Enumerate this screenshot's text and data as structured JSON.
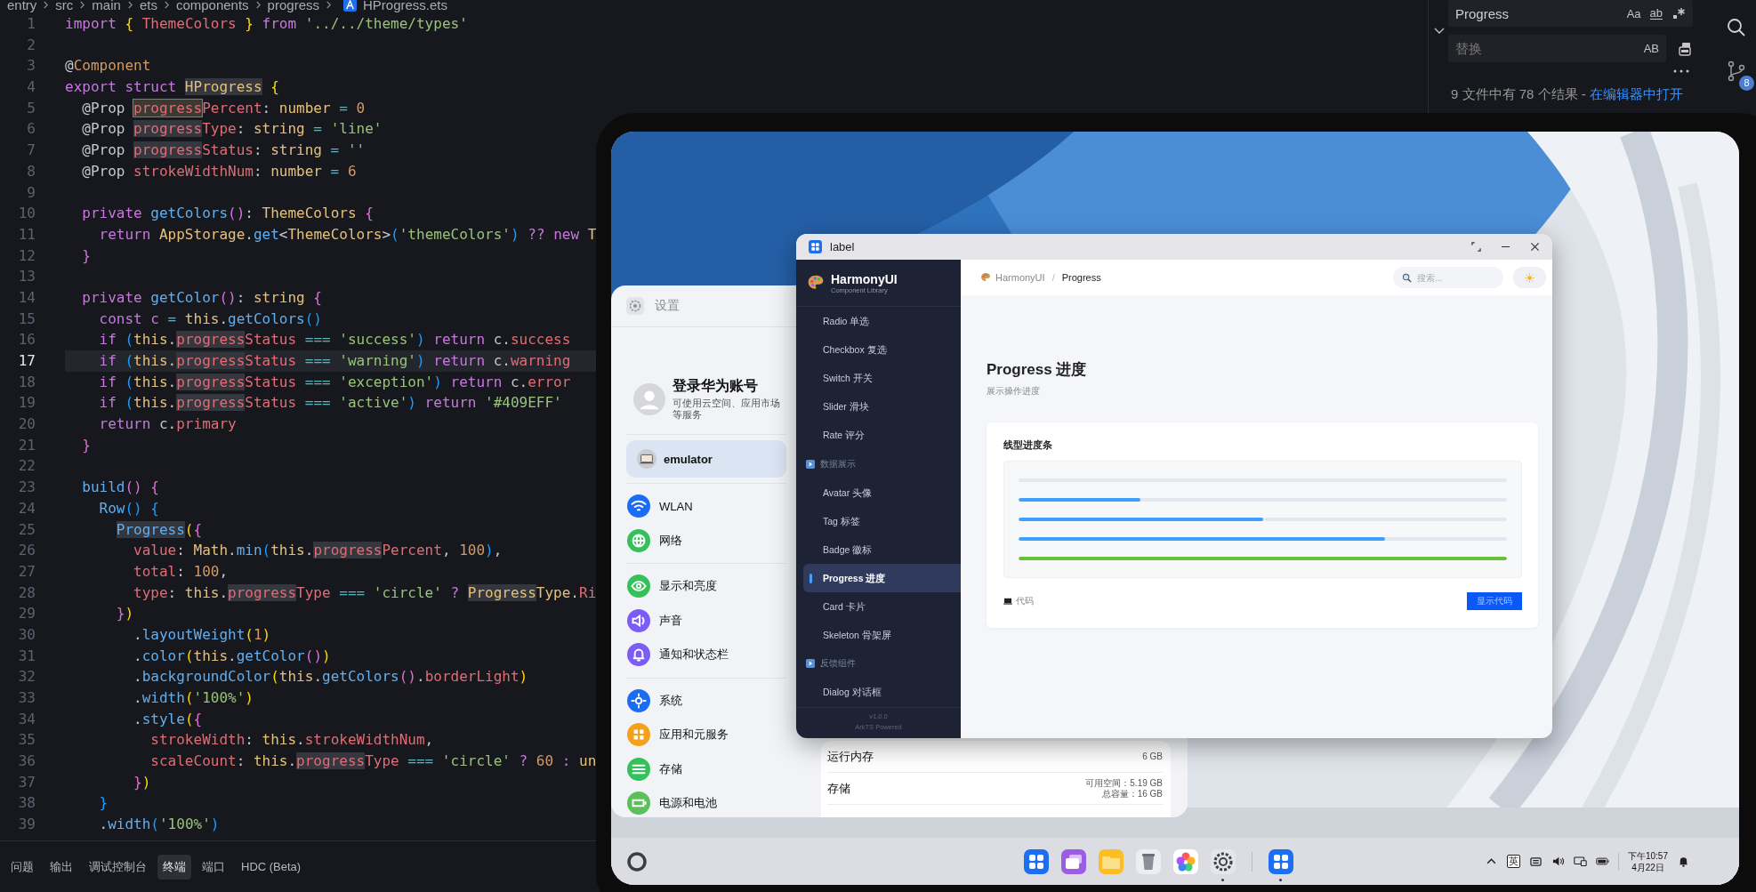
{
  "editor": {
    "breadcrumb": [
      "entry",
      "src",
      "main",
      "ets",
      "components",
      "progress",
      "HProgress.ets"
    ],
    "lines": [
      {
        "number": "1",
        "current": false,
        "tokens": [
          {
            "text": "import ",
            "kind": "kw"
          },
          {
            "text": "{",
            "kind": "b1"
          },
          {
            "text": " ThemeColors ",
            "kind": "prop"
          },
          {
            "text": "}",
            "kind": "b1"
          },
          {
            "text": " from ",
            "kind": "kw"
          },
          {
            "text": "'../../theme/types'",
            "kind": "str"
          }
        ]
      },
      {
        "number": "2",
        "current": false
      },
      {
        "number": "3",
        "current": false,
        "tokens": [
          {
            "text": "@",
            "kind": "p"
          },
          {
            "text": "Component",
            "kind": "num"
          }
        ]
      },
      {
        "number": "4",
        "current": false,
        "tokens": [
          {
            "text": "export struct ",
            "kind": "kw"
          },
          {
            "text": "HProgress",
            "kind": "typehit"
          },
          {
            "text": " {",
            "kind": "b1"
          }
        ]
      },
      {
        "number": "5",
        "current": false,
        "tokens": [
          {
            "text": "  @Prop ",
            "kind": "p"
          },
          {
            "text": "progress",
            "kind": "hitbox"
          },
          {
            "text": "Percent",
            "kind": "prop"
          },
          {
            "text": ": ",
            "kind": "p"
          },
          {
            "text": "number",
            "kind": "type"
          },
          {
            "text": " = ",
            "kind": "op"
          },
          {
            "text": "0",
            "kind": "num"
          }
        ]
      },
      {
        "number": "6",
        "current": false,
        "tokens": [
          {
            "text": "  @Prop ",
            "kind": "p"
          },
          {
            "text": "progress",
            "kind": "hit"
          },
          {
            "text": "Type",
            "kind": "prop"
          },
          {
            "text": ": ",
            "kind": "p"
          },
          {
            "text": "string",
            "kind": "type"
          },
          {
            "text": " = ",
            "kind": "op"
          },
          {
            "text": "'line'",
            "kind": "str"
          }
        ]
      },
      {
        "number": "7",
        "current": false,
        "tokens": [
          {
            "text": "  @Prop ",
            "kind": "p"
          },
          {
            "text": "progress",
            "kind": "hit"
          },
          {
            "text": "Status",
            "kind": "prop"
          },
          {
            "text": ": ",
            "kind": "p"
          },
          {
            "text": "string",
            "kind": "type"
          },
          {
            "text": " = ",
            "kind": "op"
          },
          {
            "text": "''",
            "kind": "str"
          }
        ]
      },
      {
        "number": "8",
        "current": false,
        "tokens": [
          {
            "text": "  @Prop ",
            "kind": "p"
          },
          {
            "text": "strokeWidthNum",
            "kind": "prop"
          },
          {
            "text": ": ",
            "kind": "p"
          },
          {
            "text": "number",
            "kind": "type"
          },
          {
            "text": " = ",
            "kind": "op"
          },
          {
            "text": "6",
            "kind": "num"
          }
        ]
      },
      {
        "number": "9",
        "current": false
      },
      {
        "number": "10",
        "current": false,
        "tokens": [
          {
            "text": "  private ",
            "kind": "kw"
          },
          {
            "text": "getColors",
            "kind": "fn"
          },
          {
            "text": "()",
            "kind": "b2"
          },
          {
            "text": ": ",
            "kind": "p"
          },
          {
            "text": "ThemeColors",
            "kind": "type"
          },
          {
            "text": " {",
            "kind": "b2"
          }
        ]
      },
      {
        "number": "11",
        "current": false,
        "tokens": [
          {
            "text": "    return ",
            "kind": "kw"
          },
          {
            "text": "AppStorage",
            "kind": "type"
          },
          {
            "text": ".",
            "kind": "p"
          },
          {
            "text": "get",
            "kind": "fn"
          },
          {
            "text": "<",
            "kind": "p"
          },
          {
            "text": "ThemeColors",
            "kind": "type"
          },
          {
            "text": ">",
            "kind": "p"
          },
          {
            "text": "(",
            "kind": "b3"
          },
          {
            "text": "'themeColors'",
            "kind": "str"
          },
          {
            "text": ")",
            "kind": "b3"
          },
          {
            "text": " ?? new ",
            "kind": "kw"
          },
          {
            "text": "T",
            "kind": "type"
          }
        ]
      },
      {
        "number": "12",
        "current": false,
        "tokens": [
          {
            "text": "  }",
            "kind": "b2"
          }
        ]
      },
      {
        "number": "13",
        "current": false
      },
      {
        "number": "14",
        "current": false,
        "tokens": [
          {
            "text": "  private ",
            "kind": "kw"
          },
          {
            "text": "getColor",
            "kind": "fn"
          },
          {
            "text": "()",
            "kind": "b2"
          },
          {
            "text": ": ",
            "kind": "p"
          },
          {
            "text": "string",
            "kind": "type"
          },
          {
            "text": " {",
            "kind": "b2"
          }
        ]
      },
      {
        "number": "15",
        "current": false,
        "tokens": [
          {
            "text": "    const c ",
            "kind": "kw"
          },
          {
            "text": "= ",
            "kind": "op"
          },
          {
            "text": "this",
            "kind": "type"
          },
          {
            "text": ".",
            "kind": "p"
          },
          {
            "text": "getColors",
            "kind": "fn"
          },
          {
            "text": "()",
            "kind": "b3"
          }
        ]
      },
      {
        "number": "16",
        "current": false,
        "tokens": [
          {
            "text": "    if ",
            "kind": "kw"
          },
          {
            "text": "(",
            "kind": "b3"
          },
          {
            "text": "this",
            "kind": "type"
          },
          {
            "text": ".",
            "kind": "p"
          },
          {
            "text": "progress",
            "kind": "hit"
          },
          {
            "text": "Status",
            "kind": "prop"
          },
          {
            "text": " === ",
            "kind": "op"
          },
          {
            "text": "'success'",
            "kind": "str"
          },
          {
            "text": ")",
            "kind": "b3"
          },
          {
            "text": " return ",
            "kind": "kw"
          },
          {
            "text": "c.",
            "kind": "p"
          },
          {
            "text": "success",
            "kind": "prop"
          }
        ]
      },
      {
        "number": "17",
        "current": true,
        "tokens": [
          {
            "text": "    if ",
            "kind": "kw"
          },
          {
            "text": "(",
            "kind": "b3"
          },
          {
            "text": "this",
            "kind": "type"
          },
          {
            "text": ".",
            "kind": "p"
          },
          {
            "text": "progress",
            "kind": "hit"
          },
          {
            "text": "Status",
            "kind": "prop"
          },
          {
            "text": " === ",
            "kind": "op"
          },
          {
            "text": "'warning'",
            "kind": "str"
          },
          {
            "text": ")",
            "kind": "b3"
          },
          {
            "text": " return ",
            "kind": "kw"
          },
          {
            "text": "c.",
            "kind": "p"
          },
          {
            "text": "warning",
            "kind": "prop"
          }
        ]
      },
      {
        "number": "18",
        "current": false,
        "tokens": [
          {
            "text": "    if ",
            "kind": "kw"
          },
          {
            "text": "(",
            "kind": "b3"
          },
          {
            "text": "this",
            "kind": "type"
          },
          {
            "text": ".",
            "kind": "p"
          },
          {
            "text": "progress",
            "kind": "hit"
          },
          {
            "text": "Status",
            "kind": "prop"
          },
          {
            "text": " === ",
            "kind": "op"
          },
          {
            "text": "'exception'",
            "kind": "str"
          },
          {
            "text": ")",
            "kind": "b3"
          },
          {
            "text": " return ",
            "kind": "kw"
          },
          {
            "text": "c.",
            "kind": "p"
          },
          {
            "text": "error",
            "kind": "prop"
          }
        ]
      },
      {
        "number": "19",
        "current": false,
        "tokens": [
          {
            "text": "    if ",
            "kind": "kw"
          },
          {
            "text": "(",
            "kind": "b3"
          },
          {
            "text": "this",
            "kind": "type"
          },
          {
            "text": ".",
            "kind": "p"
          },
          {
            "text": "progress",
            "kind": "hit"
          },
          {
            "text": "Status",
            "kind": "prop"
          },
          {
            "text": " === ",
            "kind": "op"
          },
          {
            "text": "'active'",
            "kind": "str"
          },
          {
            "text": ")",
            "kind": "b3"
          },
          {
            "text": " return ",
            "kind": "kw"
          },
          {
            "text": "'#409EFF'",
            "kind": "str"
          }
        ]
      },
      {
        "number": "20",
        "current": false,
        "tokens": [
          {
            "text": "    return ",
            "kind": "kw"
          },
          {
            "text": "c.",
            "kind": "p"
          },
          {
            "text": "primary",
            "kind": "prop"
          }
        ]
      },
      {
        "number": "21",
        "current": false,
        "tokens": [
          {
            "text": "  }",
            "kind": "b2"
          }
        ]
      },
      {
        "number": "22",
        "current": false
      },
      {
        "number": "23",
        "current": false,
        "tokens": [
          {
            "text": "  build",
            "kind": "fn"
          },
          {
            "text": "()",
            "kind": "b2"
          },
          {
            "text": " {",
            "kind": "b2"
          }
        ]
      },
      {
        "number": "24",
        "current": false,
        "tokens": [
          {
            "text": "    Row",
            "kind": "fn"
          },
          {
            "text": "()",
            "kind": "b3"
          },
          {
            "text": " {",
            "kind": "b3"
          }
        ]
      },
      {
        "number": "25",
        "current": false,
        "tokens": [
          {
            "text": "      Progress",
            "kind": "fnhit"
          },
          {
            "text": "(",
            "kind": "b1"
          },
          {
            "text": "{",
            "kind": "b2"
          }
        ]
      },
      {
        "number": "26",
        "current": false,
        "tokens": [
          {
            "text": "        value",
            "kind": "prop"
          },
          {
            "text": ": ",
            "kind": "p"
          },
          {
            "text": "Math",
            "kind": "type"
          },
          {
            "text": ".",
            "kind": "p"
          },
          {
            "text": "min",
            "kind": "fn"
          },
          {
            "text": "(",
            "kind": "b3"
          },
          {
            "text": "this",
            "kind": "type"
          },
          {
            "text": ".",
            "kind": "p"
          },
          {
            "text": "progress",
            "kind": "hit"
          },
          {
            "text": "Percent",
            "kind": "prop"
          },
          {
            "text": ", ",
            "kind": "p"
          },
          {
            "text": "100",
            "kind": "num"
          },
          {
            "text": ")",
            "kind": "b3"
          },
          {
            "text": ",",
            "kind": "p"
          }
        ]
      },
      {
        "number": "27",
        "current": false,
        "tokens": [
          {
            "text": "        total",
            "kind": "prop"
          },
          {
            "text": ": ",
            "kind": "p"
          },
          {
            "text": "100",
            "kind": "num"
          },
          {
            "text": ",",
            "kind": "p"
          }
        ]
      },
      {
        "number": "28",
        "current": false,
        "tokens": [
          {
            "text": "        type",
            "kind": "prop"
          },
          {
            "text": ": ",
            "kind": "p"
          },
          {
            "text": "this",
            "kind": "type"
          },
          {
            "text": ".",
            "kind": "p"
          },
          {
            "text": "progress",
            "kind": "hit"
          },
          {
            "text": "Type",
            "kind": "prop"
          },
          {
            "text": " === ",
            "kind": "op"
          },
          {
            "text": "'circle'",
            "kind": "str"
          },
          {
            "text": " ? ",
            "kind": "kw"
          },
          {
            "text": "Progress",
            "kind": "typehit"
          },
          {
            "text": "Type",
            "kind": "type"
          },
          {
            "text": ".",
            "kind": "p"
          },
          {
            "text": "Ri",
            "kind": "prop"
          }
        ]
      },
      {
        "number": "29",
        "current": false,
        "tokens": [
          {
            "text": "      }",
            "kind": "b2"
          },
          {
            "text": ")",
            "kind": "b1"
          }
        ]
      },
      {
        "number": "30",
        "current": false,
        "tokens": [
          {
            "text": "        .",
            "kind": "p"
          },
          {
            "text": "layoutWeight",
            "kind": "fn"
          },
          {
            "text": "(",
            "kind": "b1"
          },
          {
            "text": "1",
            "kind": "num"
          },
          {
            "text": ")",
            "kind": "b1"
          }
        ]
      },
      {
        "number": "31",
        "current": false,
        "tokens": [
          {
            "text": "        .",
            "kind": "p"
          },
          {
            "text": "color",
            "kind": "fn"
          },
          {
            "text": "(",
            "kind": "b1"
          },
          {
            "text": "this",
            "kind": "type"
          },
          {
            "text": ".",
            "kind": "p"
          },
          {
            "text": "getColor",
            "kind": "fn"
          },
          {
            "text": "()",
            "kind": "b2"
          },
          {
            "text": ")",
            "kind": "b1"
          }
        ]
      },
      {
        "number": "32",
        "current": false,
        "tokens": [
          {
            "text": "        .",
            "kind": "p"
          },
          {
            "text": "backgroundColor",
            "kind": "fn"
          },
          {
            "text": "(",
            "kind": "b1"
          },
          {
            "text": "this",
            "kind": "type"
          },
          {
            "text": ".",
            "kind": "p"
          },
          {
            "text": "getColors",
            "kind": "fn"
          },
          {
            "text": "()",
            "kind": "b2"
          },
          {
            "text": ".",
            "kind": "p"
          },
          {
            "text": "borderLight",
            "kind": "prop"
          },
          {
            "text": ")",
            "kind": "b1"
          }
        ]
      },
      {
        "number": "33",
        "current": false,
        "tokens": [
          {
            "text": "        .",
            "kind": "p"
          },
          {
            "text": "width",
            "kind": "fn"
          },
          {
            "text": "(",
            "kind": "b1"
          },
          {
            "text": "'100%'",
            "kind": "str"
          },
          {
            "text": ")",
            "kind": "b1"
          }
        ]
      },
      {
        "number": "34",
        "current": false,
        "tokens": [
          {
            "text": "        .",
            "kind": "p"
          },
          {
            "text": "style",
            "kind": "fn"
          },
          {
            "text": "(",
            "kind": "b1"
          },
          {
            "text": "{",
            "kind": "b2"
          }
        ]
      },
      {
        "number": "35",
        "current": false,
        "tokens": [
          {
            "text": "          strokeWidth",
            "kind": "prop"
          },
          {
            "text": ": ",
            "kind": "p"
          },
          {
            "text": "this",
            "kind": "type"
          },
          {
            "text": ".",
            "kind": "p"
          },
          {
            "text": "strokeWidthNum",
            "kind": "prop"
          },
          {
            "text": ",",
            "kind": "p"
          }
        ]
      },
      {
        "number": "36",
        "current": false,
        "tokens": [
          {
            "text": "          scaleCount",
            "kind": "prop"
          },
          {
            "text": ": ",
            "kind": "p"
          },
          {
            "text": "this",
            "kind": "type"
          },
          {
            "text": ".",
            "kind": "p"
          },
          {
            "text": "progress",
            "kind": "hit"
          },
          {
            "text": "Type",
            "kind": "prop"
          },
          {
            "text": " === ",
            "kind": "op"
          },
          {
            "text": "'circle'",
            "kind": "str"
          },
          {
            "text": " ? ",
            "kind": "kw"
          },
          {
            "text": "60",
            "kind": "num"
          },
          {
            "text": " : ",
            "kind": "kw"
          },
          {
            "text": "un",
            "kind": "type"
          }
        ]
      },
      {
        "number": "37",
        "current": false,
        "tokens": [
          {
            "text": "        }",
            "kind": "b2"
          },
          {
            "text": ")",
            "kind": "b1"
          }
        ]
      },
      {
        "number": "38",
        "current": false,
        "tokens": [
          {
            "text": "    }",
            "kind": "b3"
          }
        ]
      },
      {
        "number": "39",
        "current": false,
        "tokens": [
          {
            "text": "    .",
            "kind": "p"
          },
          {
            "text": "width",
            "kind": "fn"
          },
          {
            "text": "(",
            "kind": "b3"
          },
          {
            "text": "'100%'",
            "kind": "str"
          },
          {
            "text": ")",
            "kind": "b3"
          }
        ]
      }
    ]
  },
  "find": {
    "query": "Progress",
    "match_case": "Aa",
    "whole_word": "ab",
    "replace_placeholder": "替换",
    "preserve_case": "AB",
    "summary": "9 文件中有 78 个结果 - ",
    "open_link": "在编辑器中打开"
  },
  "activity_bar": {
    "source_control_badge": "8"
  },
  "panel_tabs": [
    {
      "label": "问题",
      "selected": false
    },
    {
      "label": "输出",
      "selected": false
    },
    {
      "label": "调试控制台",
      "selected": false
    },
    {
      "label": "终端",
      "selected": true
    },
    {
      "label": "端口",
      "selected": false
    },
    {
      "label": "HDC (Beta)",
      "selected": false
    }
  ],
  "emulator": {
    "settings": {
      "title": "设置",
      "account": {
        "title": "登录华为账号",
        "subtitle": "可使用云空间、应用市场等服务"
      },
      "device": {
        "label": "emulator",
        "selected": true
      },
      "groups": [
        {
          "items": [
            {
              "label": "WLAN",
              "color": "#1a6cf5"
            },
            {
              "label": "网络",
              "color": "#34c15b"
            }
          ]
        },
        {
          "items": [
            {
              "label": "显示和亮度",
              "color": "#34c15b"
            },
            {
              "label": "声音",
              "color": "#7c5cf6"
            },
            {
              "label": "通知和状态栏",
              "color": "#7c5cf6"
            }
          ]
        },
        {
          "items": [
            {
              "label": "系统",
              "color": "#1a6cf5"
            },
            {
              "label": "应用和元服务",
              "color": "#f5a01a"
            },
            {
              "label": "存储",
              "color": "#34c15b"
            },
            {
              "label": "电源和电池",
              "color": "#5cbf5a"
            }
          ]
        }
      ],
      "info": [
        {
          "label": "运行内存",
          "values": [
            "6 GB"
          ]
        },
        {
          "label": "存储",
          "values": [
            "可用空间：5.19 GB",
            "总容量：16 GB"
          ]
        }
      ]
    },
    "app": {
      "title": "label",
      "brand": {
        "name": "HarmonyUI",
        "tagline": "Component Library"
      },
      "nav": [
        {
          "items": [
            {
              "label": "Radio 单选",
              "selected": false
            },
            {
              "label": "Checkbox 复选",
              "selected": false
            },
            {
              "label": "Switch 开关",
              "selected": false
            },
            {
              "label": "Slider 滑块",
              "selected": false
            },
            {
              "label": "Rate 评分",
              "selected": false
            }
          ]
        },
        {
          "title": "数据展示",
          "items": [
            {
              "label": "Avatar 头像",
              "selected": false
            },
            {
              "label": "Tag 标签",
              "selected": false
            },
            {
              "label": "Badge 徽标",
              "selected": false
            },
            {
              "label": "Progress 进度",
              "selected": true
            },
            {
              "label": "Card 卡片",
              "selected": false
            },
            {
              "label": "Skeleton 骨架屏",
              "selected": false
            }
          ]
        },
        {
          "title": "反馈组件",
          "items": [
            {
              "label": "Dialog 对话框",
              "selected": false
            }
          ]
        }
      ],
      "version": "v1.0.0",
      "powered": "ArkTS Powered",
      "breadcrumb": {
        "root": "HarmonyUI",
        "separator": "/",
        "current": "Progress"
      },
      "search": {
        "placeholder": "搜索..."
      },
      "page": {
        "title": "Progress 进度",
        "subtitle": "展示操作进度"
      },
      "card": {
        "title": "线型进度条",
        "bars": [
          {
            "level": 0
          },
          {
            "level": 0.25,
            "color": "#409eff"
          },
          {
            "level": 0.5,
            "color": "#409eff"
          },
          {
            "level": 0.75,
            "color": "#409eff"
          },
          {
            "level": 1,
            "color": "#67c23a"
          }
        ],
        "code_label": "代码",
        "button": "显示代码"
      }
    },
    "taskbar": {
      "dock": [
        {
          "running": false
        },
        {
          "running": false
        },
        {
          "running": false
        },
        {
          "running": false
        },
        {
          "running": false
        },
        {
          "running": true
        },
        {
          "running": true
        }
      ],
      "input_method": "英",
      "time": "下午10:57",
      "date": "4月22日"
    }
  }
}
